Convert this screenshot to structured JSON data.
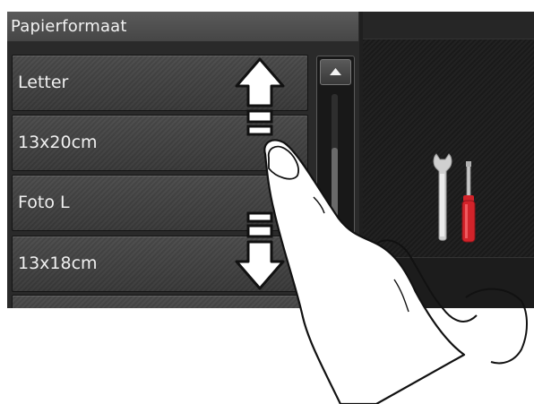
{
  "title": "Papierformaat",
  "list": {
    "items": [
      {
        "label": "Letter"
      },
      {
        "label": "13x20cm"
      },
      {
        "label": "Foto L"
      },
      {
        "label": "13x18cm"
      }
    ]
  },
  "scrollbar": {
    "up_icon": "triangle-up-icon"
  },
  "tools": {
    "icon": "wrench-screwdriver-icon",
    "colors": {
      "wrench": "#cfcfcf",
      "screwdriver_handle": "#d2232a"
    }
  },
  "gesture": {
    "icon": "swipe-finger-icon",
    "arrows": [
      "arrow-up-icon",
      "arrow-down-icon"
    ]
  }
}
